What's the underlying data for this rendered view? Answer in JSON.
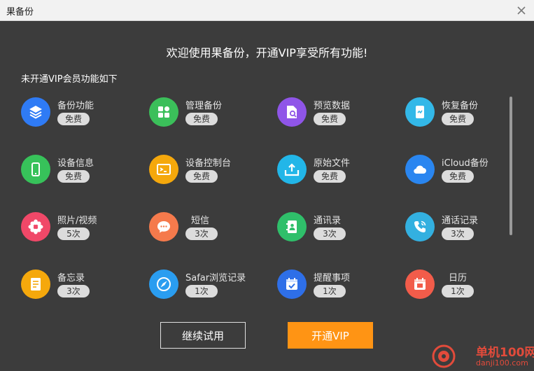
{
  "window": {
    "title": "果备份"
  },
  "headline": "欢迎使用果备份，开通VIP享受所有功能!",
  "subhead": "未开通VIP会员功能如下",
  "features": [
    {
      "name": "备份功能",
      "badge": "免费",
      "icon": "layers-icon",
      "color": "#2f7bf5"
    },
    {
      "name": "管理备份",
      "badge": "免费",
      "icon": "grid-icon",
      "color": "#3bbf5a"
    },
    {
      "name": "预览数据",
      "badge": "免费",
      "icon": "file-search-icon",
      "color": "#8f55e8"
    },
    {
      "name": "恢复备份",
      "badge": "免费",
      "icon": "phone-restore-icon",
      "color": "#33b8e8"
    },
    {
      "name": "设备信息",
      "badge": "免费",
      "icon": "phone-icon",
      "color": "#37c25a"
    },
    {
      "name": "设备控制台",
      "badge": "免费",
      "icon": "console-icon",
      "color": "#f5a80c"
    },
    {
      "name": "原始文件",
      "badge": "免费",
      "icon": "upload-tray-icon",
      "color": "#22b6e8"
    },
    {
      "name": "iCloud备份",
      "badge": "免费",
      "icon": "cloud-icon",
      "color": "#2a86f0"
    },
    {
      "name": "照片/视频",
      "badge": "5次",
      "icon": "flower-icon",
      "color": "#f04868"
    },
    {
      "name": "短信",
      "badge": "3次",
      "icon": "chat-bubble-icon",
      "color": "#f57a4c"
    },
    {
      "name": "通讯录",
      "badge": "3次",
      "icon": "contacts-icon",
      "color": "#2fbf6a"
    },
    {
      "name": "通话记录",
      "badge": "3次",
      "icon": "phone-call-icon",
      "color": "#33b0e0"
    },
    {
      "name": "备忘录",
      "badge": "3次",
      "icon": "notes-icon",
      "color": "#f5a80c"
    },
    {
      "name": "Safar浏览记录",
      "badge": "1次",
      "icon": "compass-icon",
      "color": "#2a9df0"
    },
    {
      "name": "提醒事项",
      "badge": "1次",
      "icon": "calendar-check-icon",
      "color": "#2e6fe8"
    },
    {
      "name": "日历",
      "badge": "1次",
      "icon": "calendar-icon",
      "color": "#f25c4a"
    }
  ],
  "buttons": {
    "trial": "继续试用",
    "vip": "开通VIP"
  },
  "watermark": {
    "cn": "单机100网",
    "en": "danji100.com"
  }
}
